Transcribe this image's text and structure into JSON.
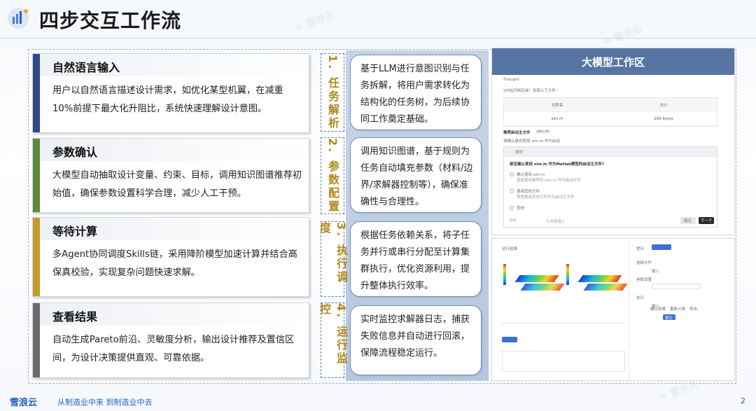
{
  "page": {
    "title": "四步交互工作流",
    "page_number": "2"
  },
  "colors": {
    "step1": "#2e4a86",
    "step2": "#5c8a3a",
    "step3": "#c39b2a",
    "step4": "#6a6a6a",
    "accent": "#5675a3",
    "label_text": "#b0891c"
  },
  "steps": [
    {
      "title": "自然语言输入",
      "desc": "用户以自然语言描述设计需求，如优化某型机翼，在减重10%前提下最大化升阻比，系统快速理解设计意图。",
      "label": "1. 任务解析",
      "detail": "基于LLM进行意图识别与任务拆解，将用户需求转化为结构化的任务树，为后续协同工作奠定基础。"
    },
    {
      "title": "参数确认",
      "desc": "大模型自动抽取设计变量、约束、目标，调用知识图谱推荐初始值，确保参数设置科学合理，减少人工干预。",
      "label": "2. 参数配置",
      "detail": "调用知识图谱，基于规则为任务自动填充参数（材料/边界/求解器控制等），确保准确性与合理性。"
    },
    {
      "title": "等待计算",
      "desc": "多Agent协同调度Skills链，采用降阶模型加速计算并结合高保真校验，实现复杂问题快速求解。",
      "label": "3. 执行调度",
      "detail": "根据任务依赖关系，将子任务并行或串行分配至计算集群执行，优化资源利用，提升整体执行效率。"
    },
    {
      "title": "查看结果",
      "desc": "自动生成Pareto前沿、灵敏度分析，输出设计推荐及置信区间，为设计决策提供直观、可靠依据。",
      "label": "4. 运行监控",
      "detail": "实时监控求解器日志，捕获失败信息并自动进行回滚，保障流程稳定运行。"
    }
  ],
  "workspace": {
    "title": "大模型工作区",
    "thought": "Thought",
    "zip_line": "ZIP包归档完成！发现以下文件：",
    "table_headers": [
      "文件名",
      "大小"
    ],
    "table_row": [
      "sim.m",
      "209 bytes"
    ],
    "recommend_label": "推荐启动主文件",
    "recommend_file": "sim.m",
    "confirm_line": "请确认是否使用 sim.m 作为启动",
    "dialog_title": "提问",
    "dialog_question": "是否确认使用 sim.m 作为Matlab模型的启动主文件?",
    "options": [
      "确认使用 sim.m",
      "使用其他文件",
      "其他"
    ],
    "option_hints": [
      "直接使用推荐的 sim.m 作为启动文件",
      "我想使用其他文件作为启动主文件"
    ],
    "pager": "1/3",
    "input_hint": "文本框输入",
    "skip_label": "跳过",
    "next_label": "下一个"
  },
  "simulation": {
    "caption": "运行结果",
    "form_labels": [
      "提问",
      "选择文件",
      "输入",
      "参数设置",
      "执行",
      "输入"
    ],
    "options": [
      "确认结果",
      "重新计算",
      "导出"
    ],
    "submit_label": "提交"
  },
  "footer": {
    "logo": "雪浪云",
    "slogan": "从制造业中来 到制造业中去"
  }
}
